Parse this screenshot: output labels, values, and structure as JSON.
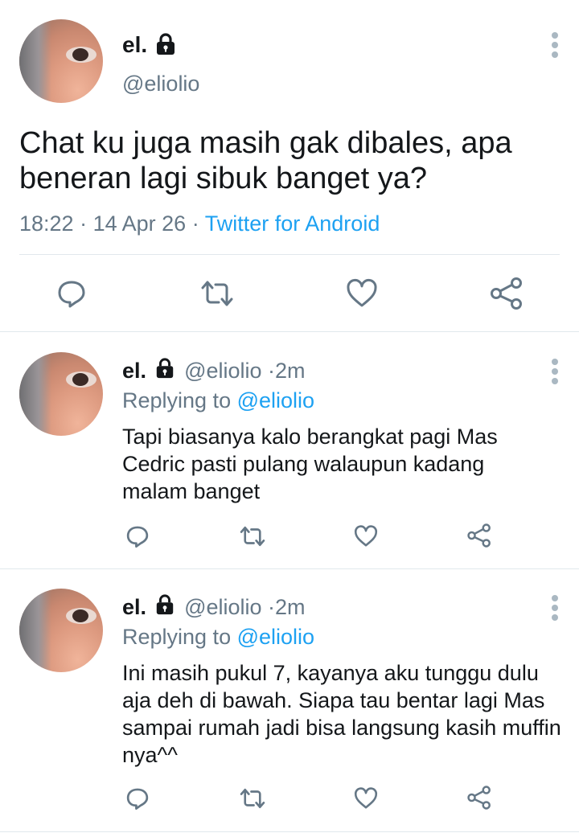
{
  "main_tweet": {
    "display_name": "el.",
    "handle": "@eliolio",
    "text": "Chat ku juga masih gak dibales, apa beneran lagi sibuk banget ya?",
    "time": "18:22",
    "separator": "·",
    "date": "14 Apr 26",
    "source": "Twitter for Android"
  },
  "replies": [
    {
      "display_name": "el.",
      "handle": "@eliolio",
      "dot": "·",
      "age": "2m",
      "replying_label": "Replying to",
      "replying_to": "@eliolio",
      "text": "Tapi biasanya kalo berangkat pagi Mas Cedric pasti pulang walaupun kadang malam banget"
    },
    {
      "display_name": "el.",
      "handle": "@eliolio",
      "dot": "·",
      "age": "2m",
      "replying_label": "Replying to",
      "replying_to": "@eliolio",
      "text": "Ini masih pukul 7, kayanya aku tunggu dulu aja deh di bawah. Siapa tau bentar lagi Mas sampai rumah jadi bisa langsung kasih muffin nya^^"
    }
  ],
  "icons": {
    "reply": "reply-icon",
    "retweet": "retweet-icon",
    "like": "heart-icon",
    "share": "share-icon",
    "lock": "lock-icon",
    "more": "more-vertical-icon"
  },
  "colors": {
    "link": "#1da1f2",
    "muted": "#657786",
    "icon": "#657786",
    "divider": "#e1e8ed"
  }
}
